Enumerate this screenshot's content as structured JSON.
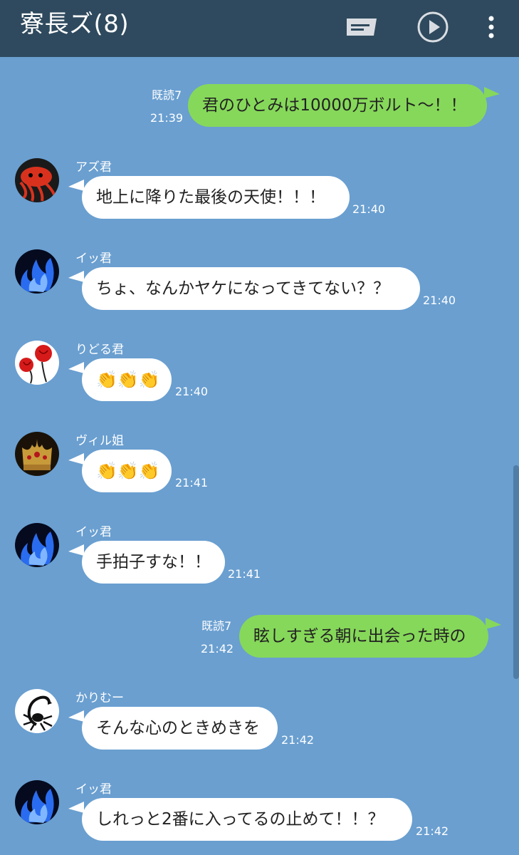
{
  "header": {
    "title": "寮長ズ(8)",
    "icons": [
      "note-icon",
      "play-icon",
      "more-vertical-icon"
    ],
    "background": "#2f4a5e"
  },
  "colors": {
    "chat_background": "#6a9fd0",
    "outgoing_bubble": "#86d85a",
    "incoming_bubble": "#ffffff"
  },
  "messages": [
    {
      "kind": "out",
      "read": "既読7",
      "time": "21:39",
      "text": "君のひとみは10000万ボルト〜！！"
    },
    {
      "kind": "in",
      "sender": "アズ君",
      "avatar": "octopus-avatar",
      "time": "21:40",
      "text": "地上に降りた最後の天使！！！"
    },
    {
      "kind": "in",
      "sender": "イッ君",
      "avatar": "blue-flame-avatar",
      "time": "21:40",
      "text": "ちょ、なんかヤケになってきてない？？"
    },
    {
      "kind": "in",
      "sender": "りどる君",
      "avatar": "roses-avatar",
      "time": "21:40",
      "text": "👏👏👏"
    },
    {
      "kind": "in",
      "sender": "ヴィル姐",
      "avatar": "crown-avatar",
      "time": "21:41",
      "text": "👏👏👏"
    },
    {
      "kind": "in",
      "sender": "イッ君",
      "avatar": "blue-flame-avatar",
      "time": "21:41",
      "text": "手拍子すな！！"
    },
    {
      "kind": "out",
      "read": "既読7",
      "time": "21:42",
      "text": "眩しすぎる朝に出会った時の"
    },
    {
      "kind": "in",
      "sender": "かりむー",
      "avatar": "scorpion-avatar",
      "time": "21:42",
      "text": "そんな心のときめきを"
    },
    {
      "kind": "in",
      "sender": "イッ君",
      "avatar": "blue-flame-avatar",
      "time": "21:42",
      "text": "しれっと2番に入ってるの止めて！！？"
    }
  ]
}
